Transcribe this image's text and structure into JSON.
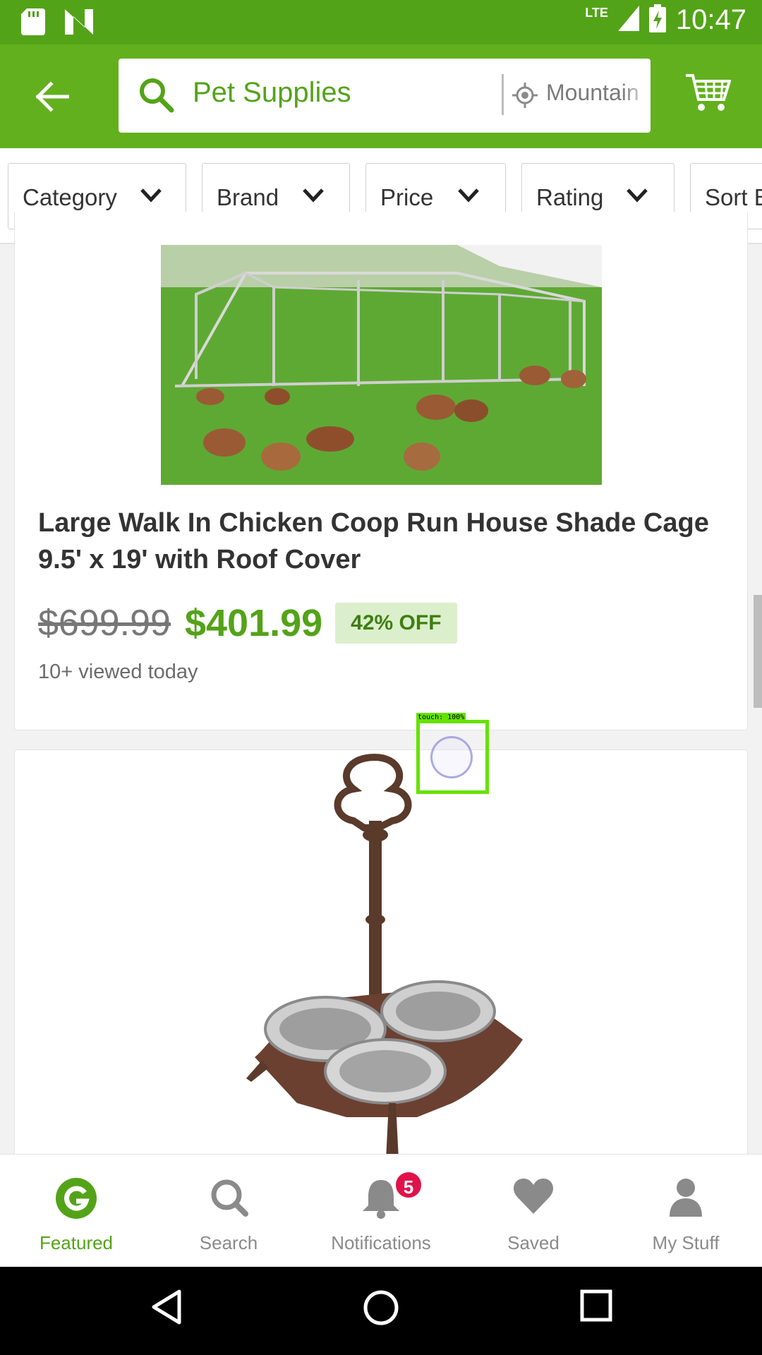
{
  "status_bar": {
    "time": "10:47",
    "network": "LTE",
    "icons": [
      "sd-card-icon",
      "n-logo-icon",
      "signal-icon",
      "battery-charging-icon"
    ]
  },
  "header": {
    "search_text": "Pet Supplies",
    "location_text": "Mountain View",
    "back_icon": "arrow-left-icon",
    "cart_icon": "cart-icon"
  },
  "filters": [
    {
      "label": "Category"
    },
    {
      "label": "Brand"
    },
    {
      "label": "Price"
    },
    {
      "label": "Rating"
    },
    {
      "label": "Sort By"
    }
  ],
  "products": [
    {
      "title": "Large Walk In Chicken Coop Run House Shade Cage 9.5' x 19' with Roof Cover",
      "old_price": "$699.99",
      "new_price": "$401.99",
      "discount": "42% OFF",
      "viewed": "10+ viewed today",
      "image": "chicken-coop-image"
    },
    {
      "image": "pet-bowl-stand-image"
    }
  ],
  "touch_overlay": {
    "label": "touch: 100%"
  },
  "bottom_nav": [
    {
      "label": "Featured",
      "icon": "groupon-g-icon",
      "active": true
    },
    {
      "label": "Search",
      "icon": "search-icon"
    },
    {
      "label": "Notifications",
      "icon": "bell-icon",
      "badge": "5"
    },
    {
      "label": "Saved",
      "icon": "heart-icon"
    },
    {
      "label": "My Stuff",
      "icon": "person-icon"
    }
  ],
  "colors": {
    "brand_green": "#53a318",
    "header_green": "#62b01e",
    "badge_red": "#e0124a"
  }
}
